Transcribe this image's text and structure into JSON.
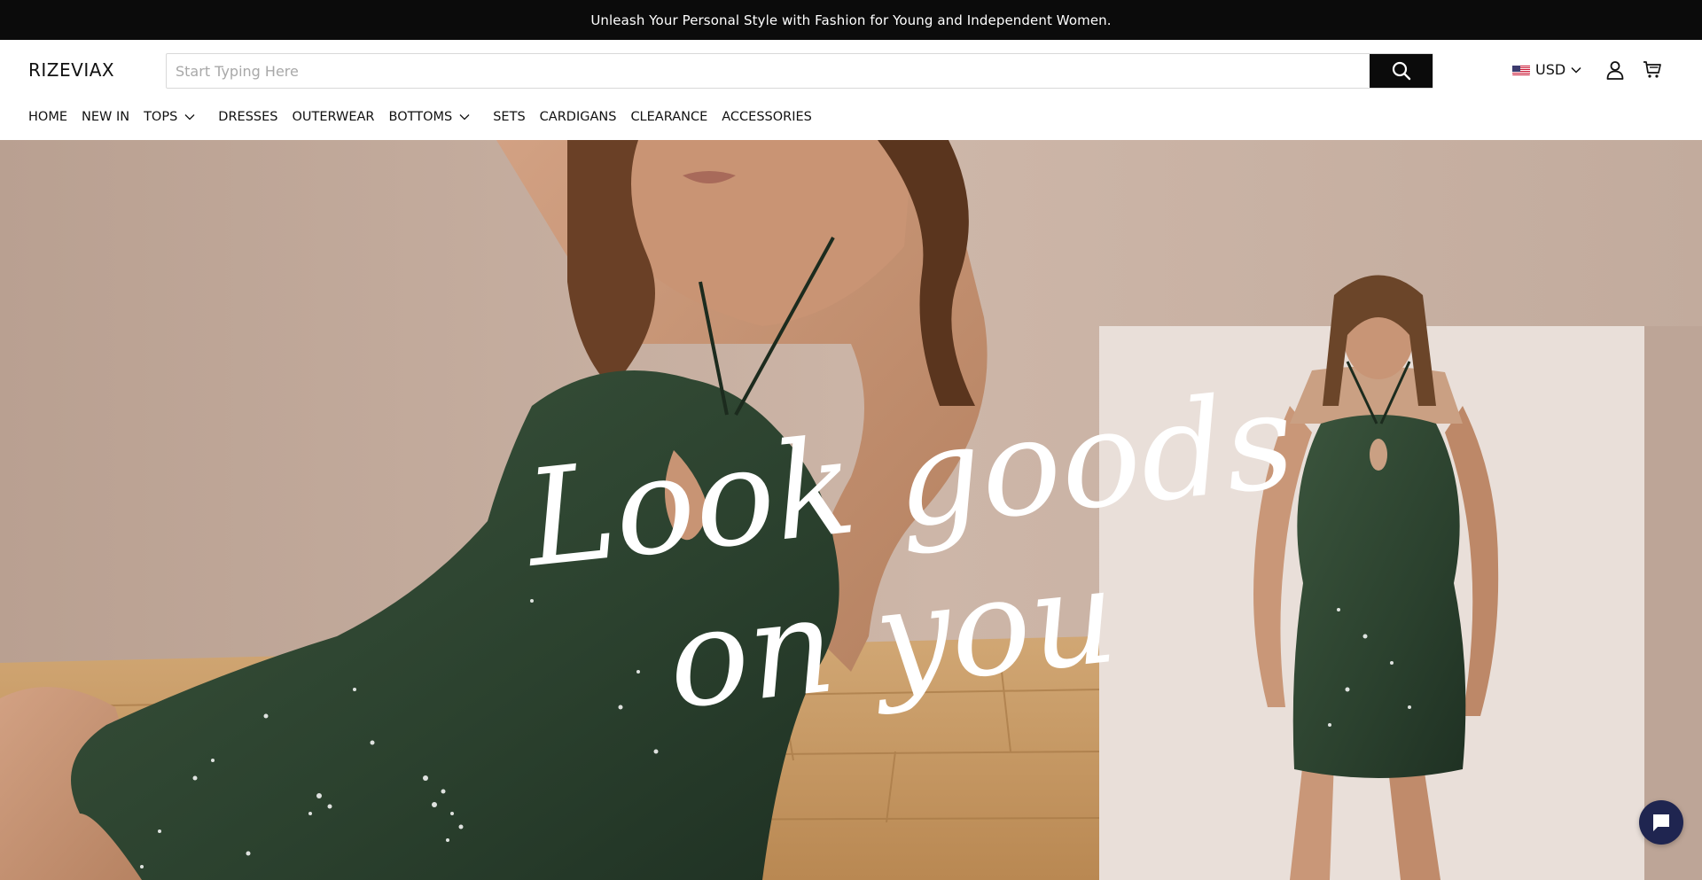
{
  "announcement": "Unleash Your Personal Style with Fashion for Young and Independent Women.",
  "header": {
    "logo": "RIZEVIAX",
    "search_placeholder": "Start Typing Here",
    "currency": "USD",
    "icons": [
      "search-icon",
      "us-flag-icon",
      "chevron-down-icon",
      "account-icon",
      "cart-icon"
    ]
  },
  "nav": {
    "items": [
      {
        "label": "HOME"
      },
      {
        "label": "NEW IN"
      },
      {
        "label": "TOPS",
        "dropdown": true
      },
      {
        "label": "DRESSES"
      },
      {
        "label": "OUTERWEAR"
      },
      {
        "label": "BOTTOMS",
        "dropdown": true
      },
      {
        "label": "SETS"
      },
      {
        "label": "CARDIGANS"
      },
      {
        "label": "CLEARANCE"
      },
      {
        "label": "ACCESSORIES"
      }
    ]
  },
  "hero": {
    "headline_line1": "Look goods",
    "headline_line2": "on you"
  },
  "colors": {
    "announcement_bg": "#0b0b0b",
    "dress_green": "#2e4430",
    "wall": "#c7b1a4",
    "floor": "#c69a64",
    "chat_button": "#1f2550"
  }
}
